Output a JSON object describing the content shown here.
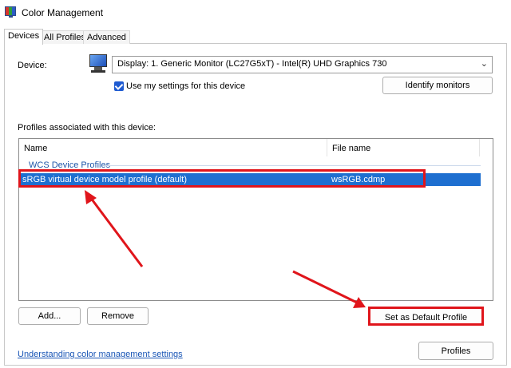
{
  "window": {
    "title": "Color Management"
  },
  "tabs": [
    {
      "label": "Devices",
      "active": true
    },
    {
      "label": "All Profiles",
      "active": false
    },
    {
      "label": "Advanced",
      "active": false
    }
  ],
  "device": {
    "label": "Device:",
    "selected": "Display: 1. Generic Monitor (LC27G5xT) - Intel(R) UHD Graphics 730",
    "use_my_settings_label": "Use my settings for this device",
    "use_my_settings_checked": true,
    "identify_button": "Identify monitors"
  },
  "profiles": {
    "label": "Profiles associated with this device:",
    "columns": [
      "Name",
      "File name"
    ],
    "group": "WCS Device Profiles",
    "rows": [
      {
        "name": "sRGB virtual device model profile (default)",
        "file": "wsRGB.cdmp",
        "selected": true
      }
    ]
  },
  "buttons": {
    "add": "Add...",
    "remove": "Remove",
    "set_default": "Set as Default Profile",
    "profiles": "Profiles"
  },
  "footer": {
    "link": "Understanding color management settings"
  },
  "colors": {
    "selection": "#1e6fd0",
    "annotation": "#e0151b",
    "link": "#1a56b6",
    "group_text": "#1e56a8"
  },
  "icons": [
    "color-management-icon",
    "monitor-icon",
    "chevron-down-icon",
    "checkmark-icon"
  ]
}
